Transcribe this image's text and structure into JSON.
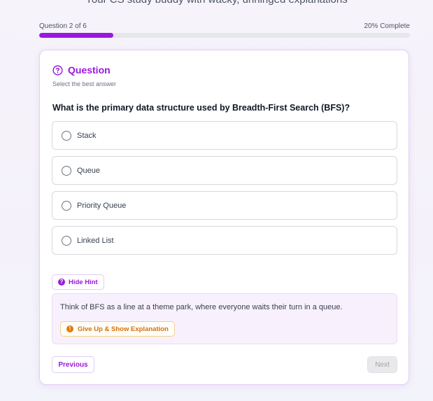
{
  "header": {
    "subtitle": "Your CS study buddy with wacky, unhinged explanations"
  },
  "progress": {
    "question_label": "Question 2 of 6",
    "complete_label": "20% Complete",
    "fraction": 0.2
  },
  "question": {
    "heading": "Question",
    "instruction": "Select the best answer",
    "text": "What is the primary data structure used by Breadth-First Search (BFS)?",
    "options": [
      {
        "label": "Stack"
      },
      {
        "label": "Queue"
      },
      {
        "label": "Priority Queue"
      },
      {
        "label": "Linked List"
      }
    ]
  },
  "hint": {
    "toggle_label": "Hide Hint",
    "icon": "question-circle-icon",
    "text": "Think of BFS as a line at a theme park, where everyone waits their turn in a queue.",
    "give_up_label": "Give Up & Show Explanation",
    "give_up_icon": "exclamation-circle-icon"
  },
  "nav": {
    "previous_label": "Previous",
    "next_label": "Next",
    "next_disabled": true
  },
  "colors": {
    "accent": "#9b17e0",
    "warning": "#e07b0a"
  }
}
